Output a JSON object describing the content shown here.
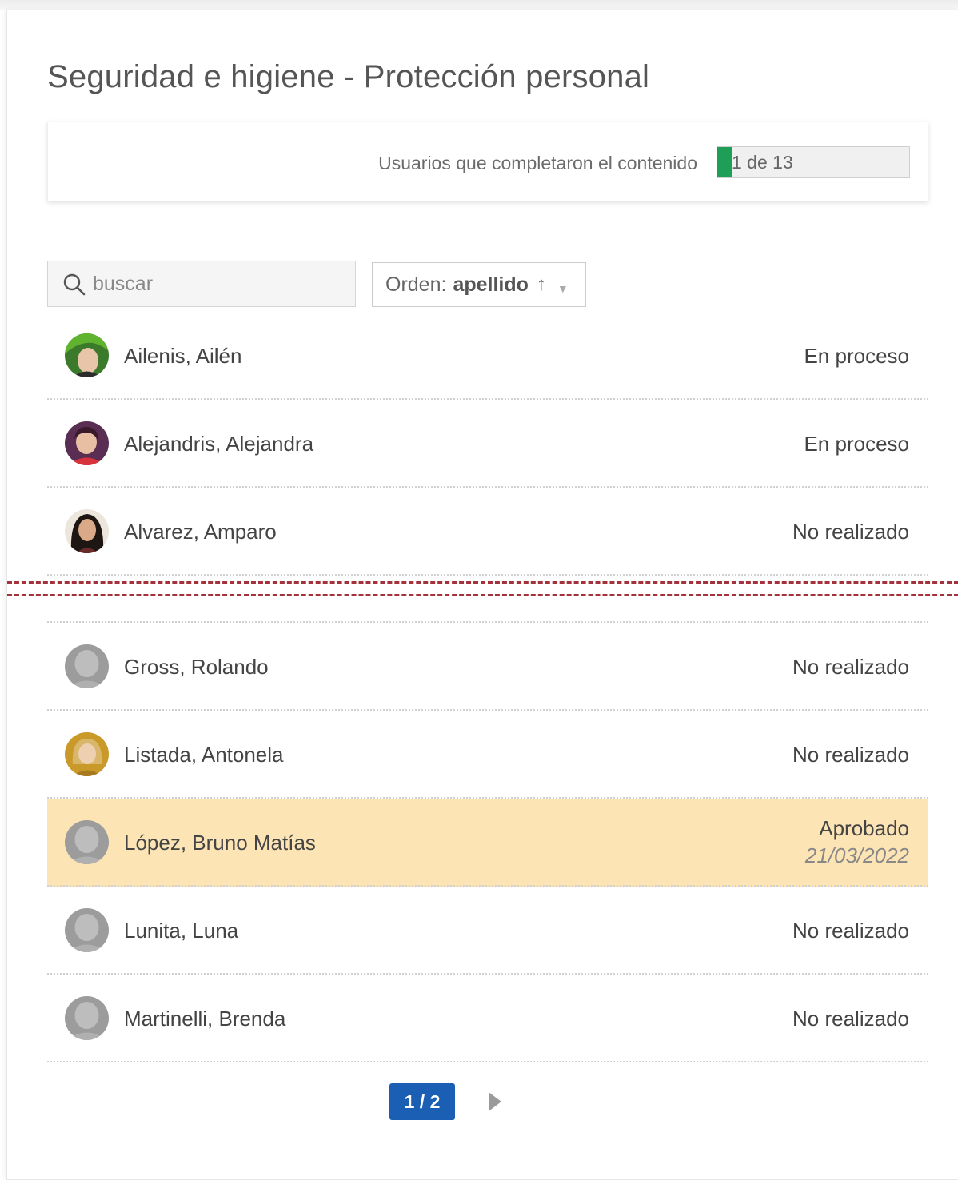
{
  "page": {
    "title": "Seguridad e higiene - Protección personal"
  },
  "progress": {
    "label": "Usuarios que completaron el contenido",
    "text": "1 de 13",
    "completed": 1,
    "total": 13,
    "fill_color": "#1e9e57"
  },
  "search": {
    "placeholder": "buscar",
    "value": "",
    "icon": "search-icon"
  },
  "sort": {
    "prefix": "Orden:",
    "value": "apellido",
    "direction_glyph": "↑",
    "caret_glyph": "▼"
  },
  "users": [
    {
      "name": "Ailenis, Ailén",
      "status": "En proceso",
      "date": "",
      "avatar": "photo"
    },
    {
      "name": "Alejandris, Alejandra",
      "status": "En proceso",
      "date": "",
      "avatar": "photo"
    },
    {
      "name": "Alvarez, Amparo",
      "status": "No realizado",
      "date": "",
      "avatar": "photo"
    },
    {
      "name": "Gross, Rolando",
      "status": "No realizado",
      "date": "",
      "avatar": "default"
    },
    {
      "name": "Listada, Antonela",
      "status": "No realizado",
      "date": "",
      "avatar": "photo"
    },
    {
      "name": "López, Bruno Matías",
      "status": "Aprobado",
      "date": "21/03/2022",
      "avatar": "default",
      "highlighted": true
    },
    {
      "name": "Lunita, Luna",
      "status": "No realizado",
      "date": "",
      "avatar": "default"
    },
    {
      "name": "Martinelli, Brenda",
      "status": "No realizado",
      "date": "",
      "avatar": "default"
    }
  ],
  "pagination": {
    "current": "1 / 2",
    "next_icon": "chevron-right-icon"
  },
  "colors": {
    "highlight_row": "#fce4b5",
    "pager_active": "#1a5fb4",
    "cut_line": "#a3323a"
  }
}
